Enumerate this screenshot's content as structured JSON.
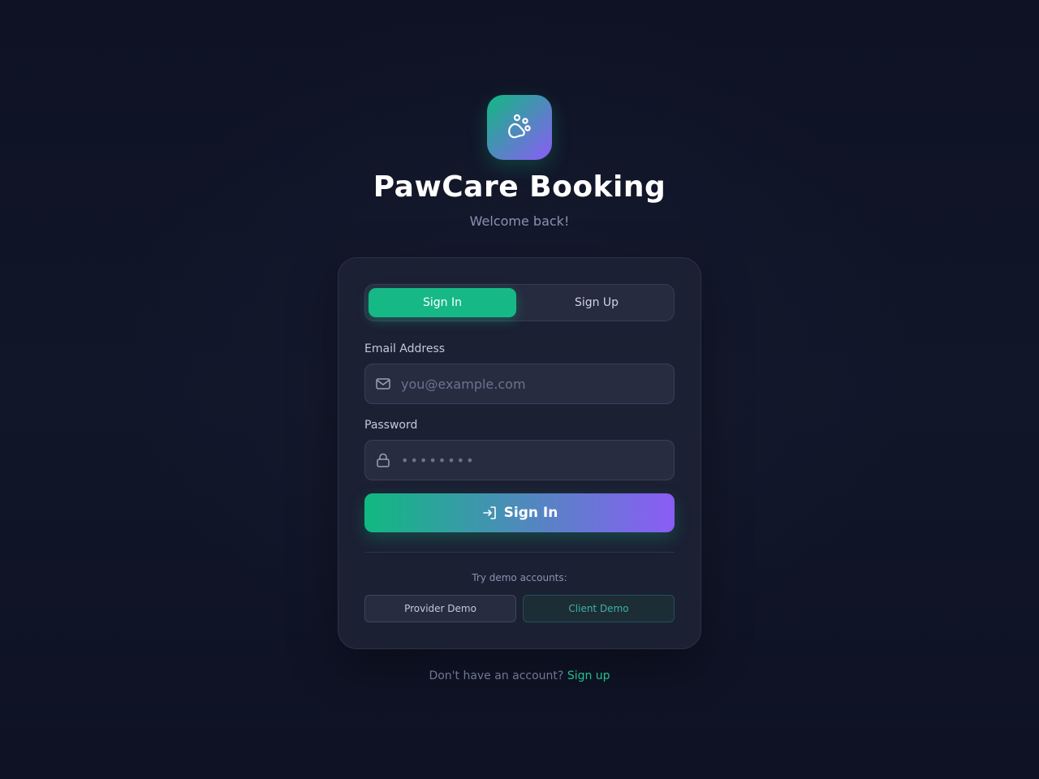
{
  "app": {
    "title": "PawCare Booking",
    "subtitle": "Welcome back!",
    "logo_icon": "paw-icon"
  },
  "tabs": [
    {
      "label": "Sign In",
      "active": true
    },
    {
      "label": "Sign Up",
      "active": false
    }
  ],
  "form": {
    "email": {
      "label": "Email Address",
      "placeholder": "you@example.com",
      "value": "",
      "icon": "mail-icon"
    },
    "password": {
      "label": "Password",
      "placeholder": "••••••••",
      "value": "",
      "icon": "lock-icon"
    },
    "submit": {
      "label": "Sign In",
      "icon": "login-icon"
    }
  },
  "demo": {
    "label": "Try demo accounts:",
    "provider_label": "Provider Demo",
    "client_label": "Client Demo"
  },
  "footer": {
    "text": "Don't have an account?",
    "link": "Sign up"
  },
  "colors": {
    "accent_green": "#10b981",
    "accent_purple": "#8b5cf6",
    "background": "#0e1224",
    "card": "#1b2033"
  }
}
